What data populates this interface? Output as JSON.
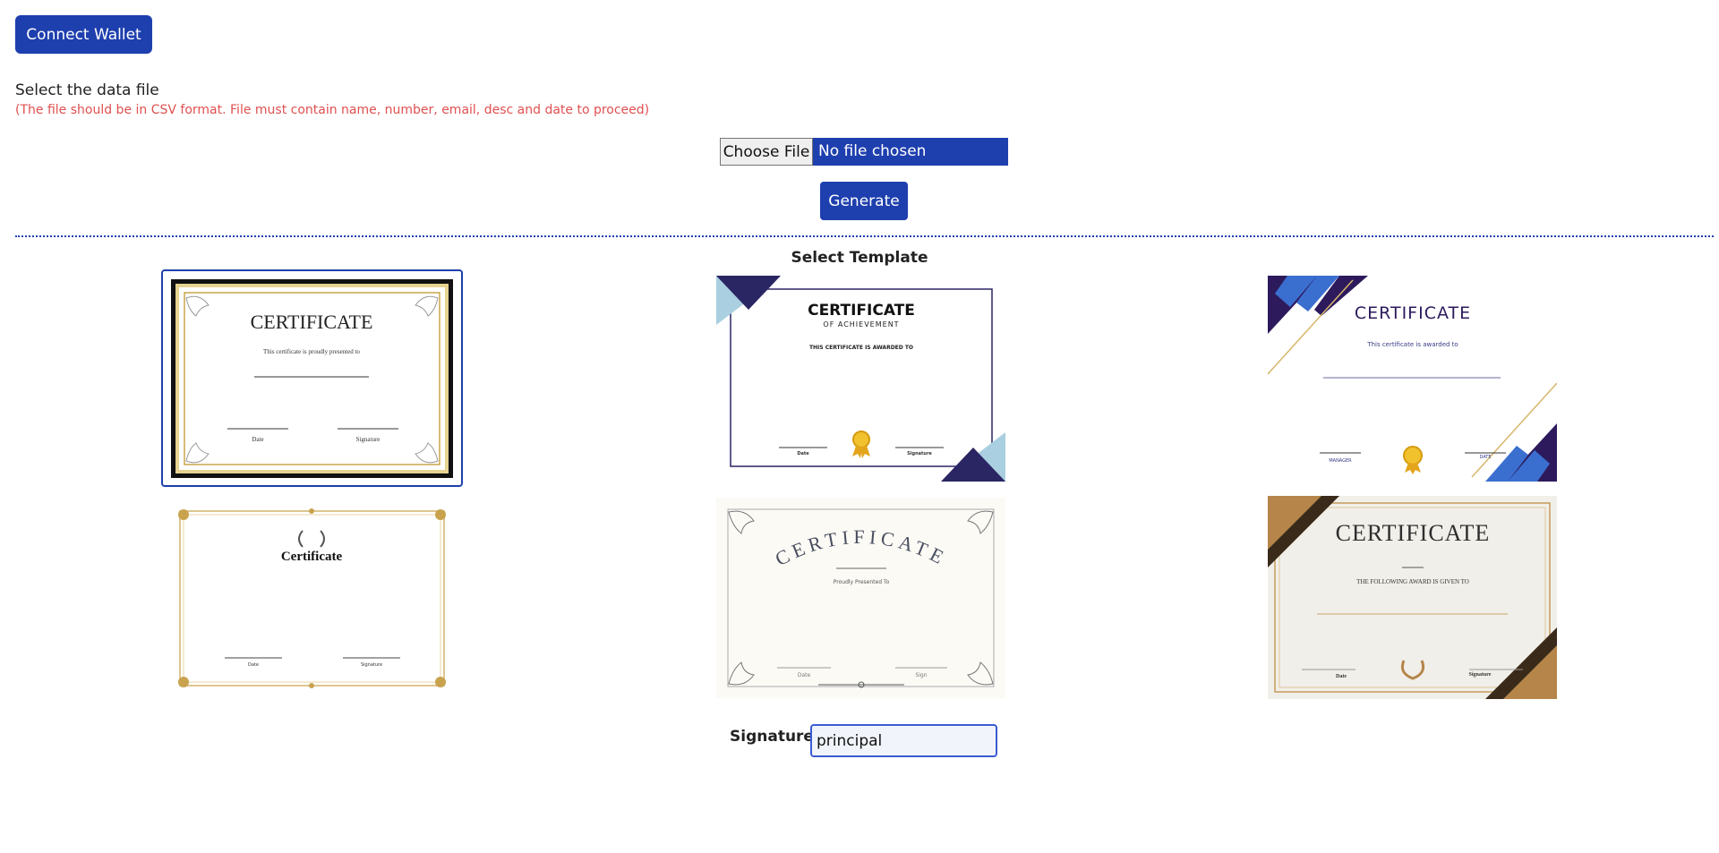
{
  "header": {
    "connect_wallet_label": "Connect Wallet"
  },
  "upload": {
    "label": "Select the data file",
    "hint": "(The file should be in CSV format. File must contain name, number, email, desc and date to proceed)",
    "choose_file_label": "Choose File",
    "file_status": "No file chosen",
    "generate_label": "Generate"
  },
  "templates": {
    "heading": "Select Template",
    "selected_index": 0,
    "items": [
      {
        "title": "CERTIFICATE",
        "line1": "This certificate is proudly presented to",
        "left": "Date",
        "right": "Signature"
      },
      {
        "title": "CERTIFICATE",
        "subtitle": "OF ACHIEVEMENT",
        "line1": "THIS CERTIFICATE IS AWARDED TO",
        "left": "Date",
        "right": "Signature"
      },
      {
        "title": "CERTIFICATE",
        "line1": "This certificate is awarded to",
        "left": "MANAGER",
        "right": "DATE"
      },
      {
        "title": "Certificate",
        "left": "Date",
        "right": "Signature"
      },
      {
        "title": "CERTIFICATE",
        "line1": "Proudly Presented To",
        "left": "Date",
        "right": "Sign"
      },
      {
        "title": "CERTIFICATE",
        "line1": "THE FOLLOWING AWARD IS GIVEN TO",
        "left": "Date",
        "right": "Signature"
      }
    ]
  },
  "signature": {
    "label": "Signature:",
    "value": "principal"
  }
}
